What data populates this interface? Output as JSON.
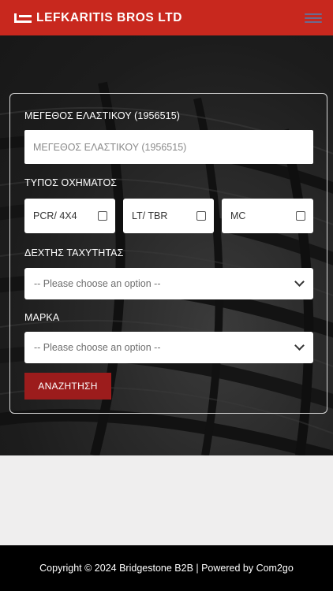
{
  "header": {
    "brand_name": "LEFKARITIS BROS LTD",
    "brand_color": "#c8281e",
    "menu_icon": "hamburger-menu-icon"
  },
  "hero": {
    "background_image": "tire-tread-photo"
  },
  "search_form": {
    "size_label": "ΜΕΓΕΘΟΣ ΕΛΑΣΤΙΚΟΥ (1956515)",
    "size_placeholder": "ΜΕΓΕΘΟΣ ΕΛΑΣΤΙΚΟΥ (1956515)",
    "vehicle_type_label": "ΤΥΠΟΣ ΟΧΗΜΑΤΟΣ",
    "vehicle_types": [
      {
        "label": "PCR/ 4X4",
        "checked": false
      },
      {
        "label": "LT/ TBR",
        "checked": false
      },
      {
        "label": "MC",
        "checked": false
      }
    ],
    "speed_index_label": "ΔΕΧΤΗΣ ΤΑΧΥΤΗΤΑΣ",
    "speed_index_value": "-- Please choose an option --",
    "brand_label": "ΜΑΡΚΑ",
    "brand_value": "-- Please choose an option --",
    "search_button": "ΑΝΑΖΗΤΗΣΗ",
    "button_color": "#9c1c1c"
  },
  "footer": {
    "copyright": "Copyright © 2024 Bridgestone B2B | Powered by Com2go"
  }
}
